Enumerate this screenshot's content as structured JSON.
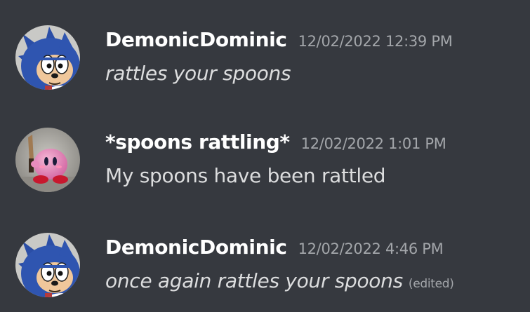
{
  "colors": {
    "background": "#36393f",
    "username": "#ffffff",
    "timestamp": "#a3a6aa",
    "message_text": "#dcddde"
  },
  "messages": [
    {
      "avatar_icon": "sonic-avatar-icon",
      "username": "DemonicDominic",
      "timestamp": "12/02/2022 12:39 PM",
      "text": "rattles your spoons",
      "style": "italic"
    },
    {
      "avatar_icon": "kirby-knife-avatar-icon",
      "username": "*spoons rattling*",
      "timestamp": "12/02/2022 1:01 PM",
      "text": "My spoons have been rattled",
      "style": "normal"
    },
    {
      "avatar_icon": "sonic-avatar-icon",
      "username": "DemonicDominic",
      "timestamp": "12/02/2022 4:46 PM",
      "text": "once again rattles your spoons",
      "style": "italic",
      "edited_label": "(edited)"
    }
  ]
}
